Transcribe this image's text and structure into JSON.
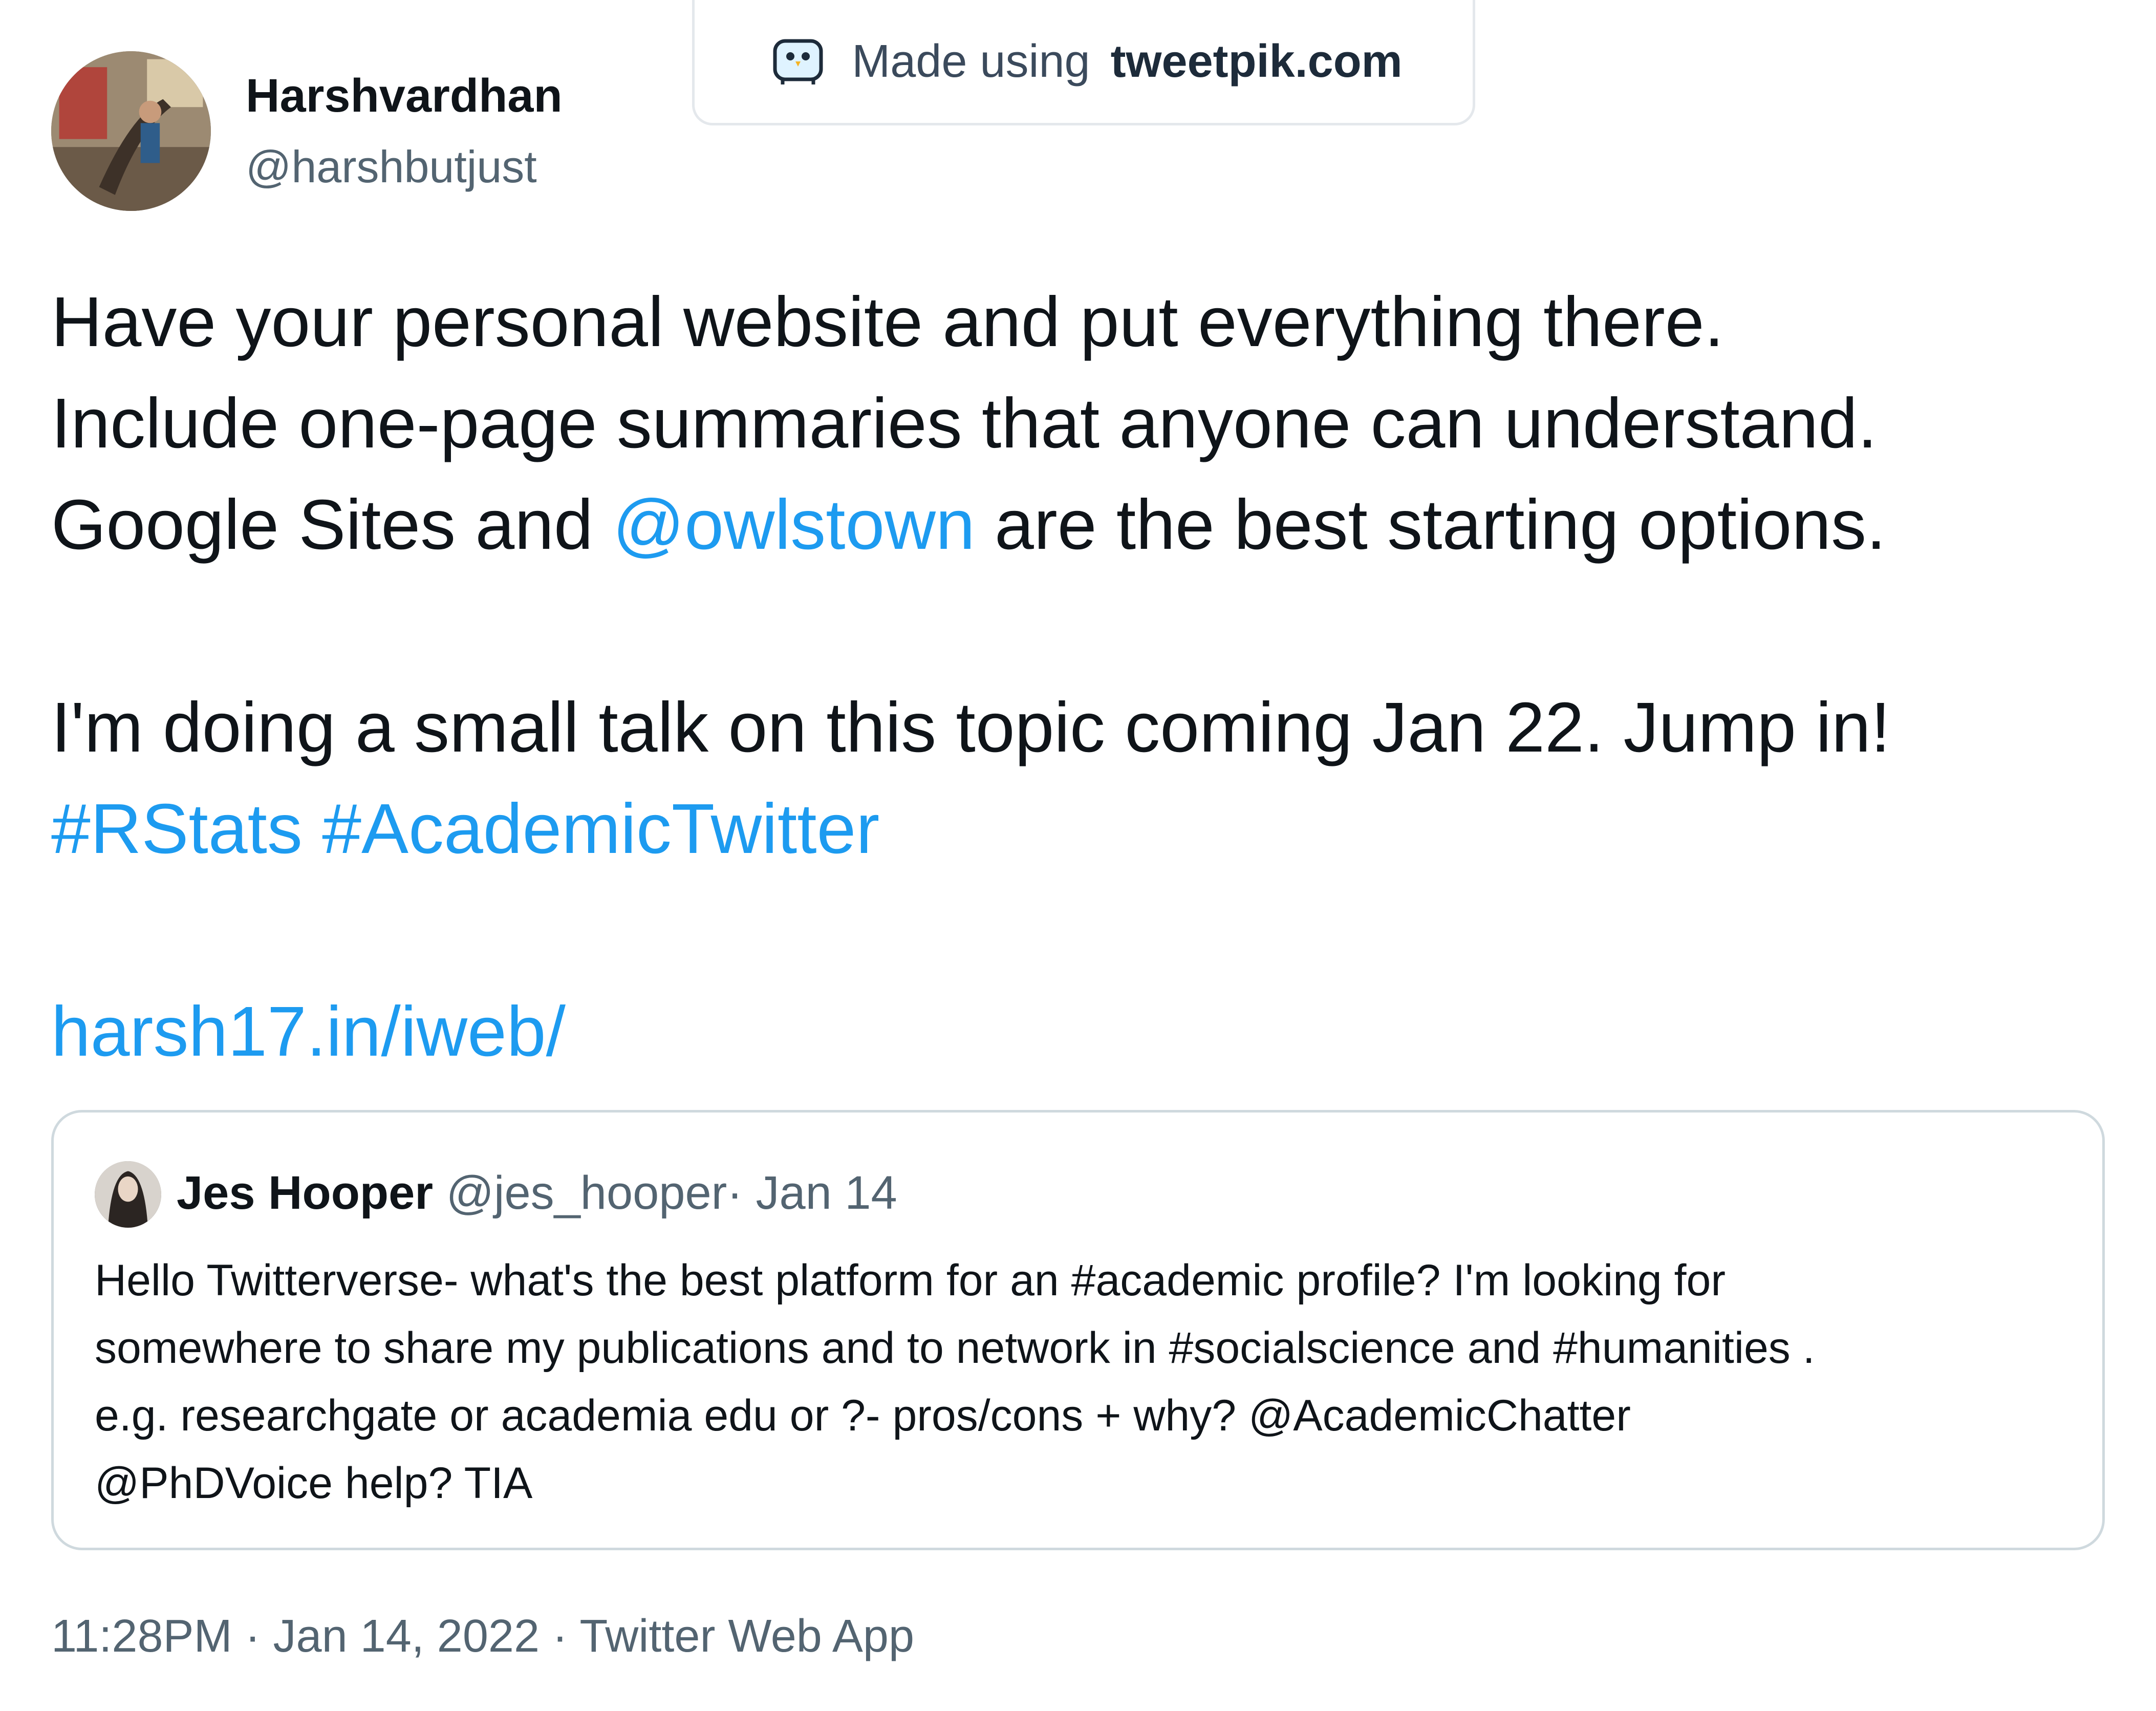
{
  "watermark": {
    "prefix": "Made using",
    "brand": "tweetpik.com"
  },
  "author": {
    "name": "Harshvardhan",
    "handle": "@harshbutjust"
  },
  "tweet": {
    "line1": "Have your personal website and put everything there.",
    "line2": "Include one-page summaries that anyone can understand.",
    "line3_before": "Google Sites and ",
    "line3_mention": "@owlstown",
    "line3_after": " are the best starting options.",
    "line4": "I'm doing a small talk on this topic coming Jan 22. Jump in!",
    "hashtag1": "#RStats",
    "hashtag2": "#AcademicTwitter",
    "url": "harsh17.in/iweb/"
  },
  "quoted": {
    "name": "Jes Hooper",
    "handle": "@jes_hooper",
    "date": "Jan 14",
    "line1": "Hello Twitterverse- what's the best platform for an #academic profile? I'm looking for",
    "line2": "somewhere to share my publications and to network in #socialscience and #humanities .",
    "line3": "e.g. researchgate or academia edu or ?- pros/cons + why?  @AcademicChatter",
    "line4": "@PhDVoice help? TIA"
  },
  "footer": {
    "time": "11:28PM",
    "date": "Jan 14, 2022",
    "source": "Twitter Web App"
  },
  "colors": {
    "link": "#1d9bf0",
    "text": "#0f1419",
    "secondary": "#536471",
    "border": "#cfd9de"
  }
}
